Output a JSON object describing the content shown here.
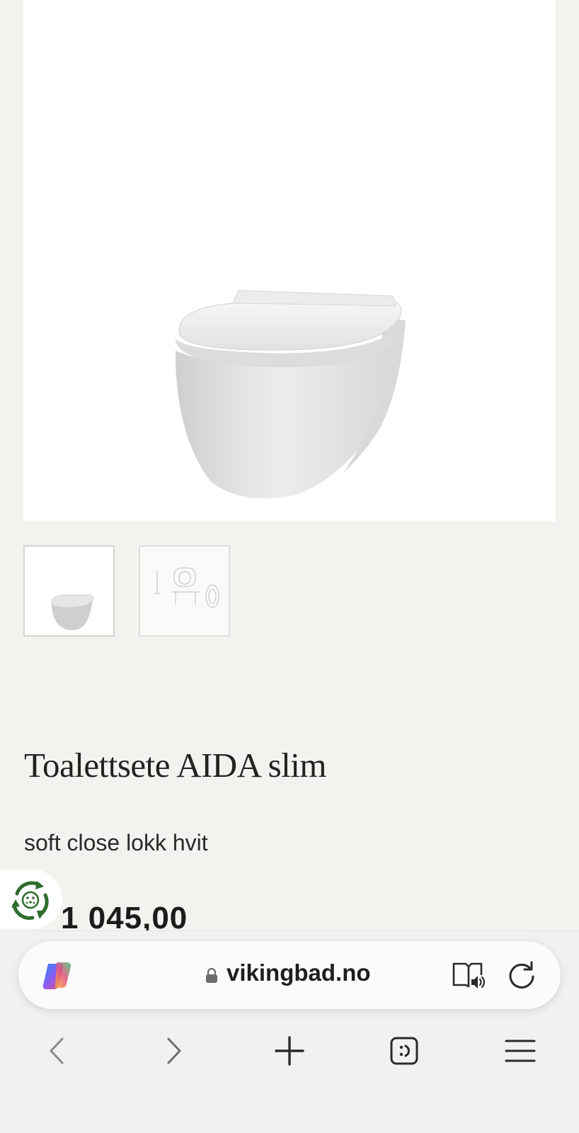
{
  "product": {
    "title": "Toalettsete AIDA slim",
    "subtitle": "soft close lokk hvit",
    "price": "1 045,00"
  },
  "gallery": {
    "thumbnails": [
      "toilet-photo",
      "technical-drawing"
    ]
  },
  "browser": {
    "url": "vikingbad.no",
    "icons": [
      "copilot-icon",
      "lock-icon",
      "reader-mode-icon",
      "reload-icon",
      "back-icon",
      "forward-icon",
      "new-tab-icon",
      "tabs-icon",
      "menu-icon"
    ]
  },
  "colors": {
    "background": "#f3f2ef",
    "eco_green": "#2e7d32"
  }
}
